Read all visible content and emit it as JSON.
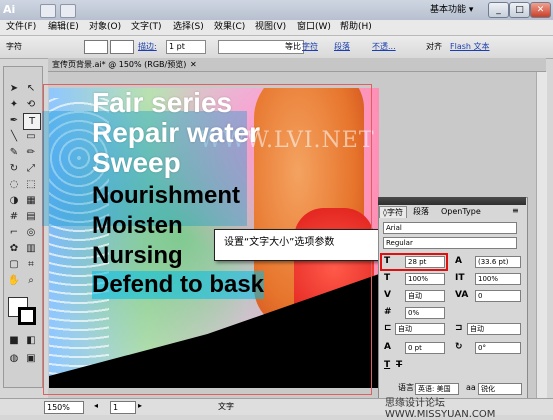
{
  "app": {
    "logo": "Ai",
    "workspace": "基本功能 ▾"
  },
  "window_controls": {
    "minimize": "_",
    "restore": "□",
    "close": "✕"
  },
  "menus": [
    "文件(F)",
    "编辑(E)",
    "对象(O)",
    "文字(T)",
    "选择(S)",
    "效果(C)",
    "视图(V)",
    "窗口(W)",
    "帮助(H)"
  ],
  "control_bar": {
    "label": "字符",
    "stroke_label": "描边:",
    "stroke_weight": "1 pt",
    "stroke_profile": "等比",
    "char_link": "字符",
    "para_link": "段落",
    "opacity_link": "不透...",
    "align_link": "对齐",
    "flash_text": "Flash 文本"
  },
  "document_tab": {
    "title": "宣传页背景.ai* @ 150% (RGB/预览)",
    "close": "✕"
  },
  "artwork": {
    "lines": [
      "Fair series",
      "Repair water",
      "Sweep",
      "Nourishment",
      "Moisten",
      "Nursing",
      "Defend to bask"
    ],
    "watermark": "WWW.LVI.NET"
  },
  "callout": {
    "text": "设置“文字大小”选项参数"
  },
  "char_panel": {
    "tabs": [
      "◊字符",
      "段落",
      "OpenType"
    ],
    "font_family": "Arial",
    "font_style": "Regular",
    "font_size": "28 pt",
    "leading": "(33.6 pt)",
    "horiz_scale": "100%",
    "vert_scale": "100%",
    "kerning": "自动",
    "tracking": "0",
    "tsume": "0%",
    "mojikumi_left": "自动",
    "mojikumi_right": "自动",
    "baseline_shift": "0 pt",
    "rotation": "0°",
    "language_label": "语言:",
    "language": "英语: 美国",
    "smoothing": "锐化"
  },
  "status_bar": {
    "zoom": "150%",
    "page": "1",
    "tool_text": "文字"
  },
  "site_watermark": "思缘设计论坛 WWW.MISSYUAN.COM",
  "colors": {
    "title_bar": "#c2cad8",
    "highlight": "#e01010",
    "selection": "#0096d2"
  }
}
